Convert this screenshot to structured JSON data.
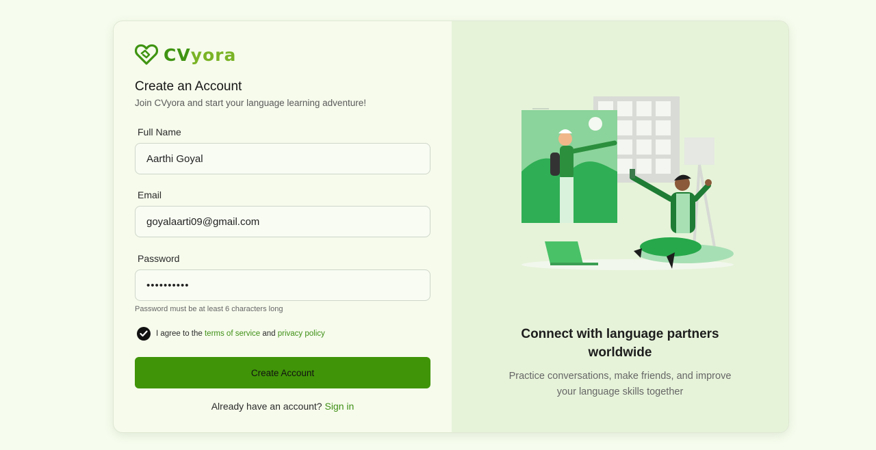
{
  "brand": {
    "name_prefix": "CV",
    "name_suffix": "yora"
  },
  "form": {
    "title": "Create an Account",
    "subtitle": "Join CVyora and start your language learning adventure!",
    "full_name": {
      "label": "Full Name",
      "value": "Aarthi Goyal"
    },
    "email": {
      "label": "Email",
      "value": "goyalaarti09@gmail.com"
    },
    "password": {
      "label": "Password",
      "value": "••••••••••",
      "hint": "Password must be at least 6 characters long"
    },
    "agree": {
      "checked": true,
      "prefix": "I agree to the",
      "terms_link": "terms of service",
      "conjunction": "and",
      "privacy_link": "privacy policy"
    },
    "submit_label": "Create Account",
    "signin_prompt": "Already have an account?",
    "signin_link": "Sign in"
  },
  "promo": {
    "title": "Connect with language partners worldwide",
    "subtitle": "Practice conversations, make friends, and improve your language skills together"
  },
  "colors": {
    "primary": "#409408",
    "accent": "#7ab326",
    "panel": "#e6f3d9",
    "background": "#f7fdee"
  },
  "icons": {
    "logo": "heart-handshake-icon",
    "check": "check-icon"
  }
}
